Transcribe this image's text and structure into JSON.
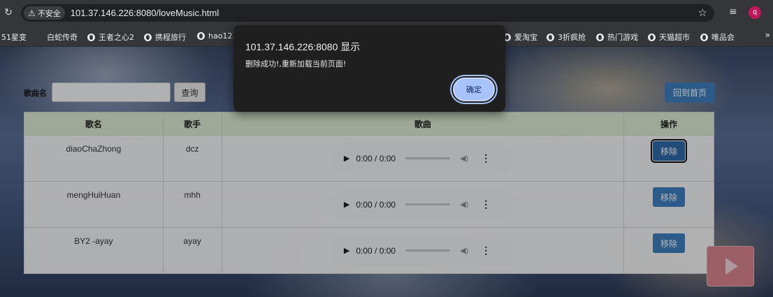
{
  "browser": {
    "security_label": "不安全",
    "url": "101.37.146.226:8080/loveMusic.html",
    "profile_initial": "q",
    "icons": {
      "reload": "reload-icon",
      "star": "star-icon",
      "media": "media-controls-icon",
      "warning": "warning-icon"
    }
  },
  "bookmarks": {
    "items": [
      "51星变",
      "白蛇传奇",
      "王者之心2",
      "携程旅行",
      "hao123",
      "爱淘宝",
      "3折疯抢",
      "热门游戏",
      "天猫超市",
      "唯品会"
    ],
    "more": "»"
  },
  "search": {
    "label": "歌曲名",
    "value": "",
    "button": "查询"
  },
  "home_button": "回到首页",
  "table": {
    "headers": [
      "歌名",
      "歌手",
      "歌曲",
      "操作"
    ],
    "rows": [
      {
        "title": "diaoChaZhong",
        "singer": "dcz",
        "time": "0:00 / 0:00",
        "action": "移除"
      },
      {
        "title": "mengHuiHuan",
        "singer": "mhh",
        "time": "0:00 / 0:00",
        "action": "移除"
      },
      {
        "title": "BY2 -ayay",
        "singer": "ayay",
        "time": "0:00 / 0:00",
        "action": "移除"
      }
    ]
  },
  "dialog": {
    "title": "101.37.146.226:8080 显示",
    "message": "删除成功!,重新加载当前页面!",
    "ok": "确定"
  },
  "colors": {
    "accent": "#3d7ec0",
    "header_bg": "#dcebd2",
    "dialog_bg": "#1f1f1f",
    "ok_button": "#a8c2fb",
    "float_player": "#d9848d"
  }
}
